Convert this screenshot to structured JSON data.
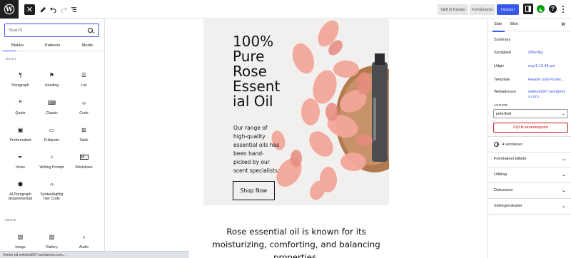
{
  "toolbar": {
    "logo_icon": "wordpress-logo",
    "inserter_icon": "close-icon",
    "tools_icon": "pen-icon",
    "undo_icon": "undo-icon",
    "redo_icon": "redo-icon",
    "outline_icon": "list-view-icon",
    "draft_label": "Skift til Kladde",
    "preview_label": "Forhåndsvis",
    "update_label": "Opdater",
    "settings_icon": "sidebar-icon",
    "jetpack_icon": "jetpack-icon",
    "help_label": "?",
    "more_icon": "more-vertical-icon"
  },
  "inserter": {
    "search_placeholder": "Search",
    "tabs": [
      "Blokke",
      "Patterns",
      "Medie"
    ],
    "active_tab": "Blokke",
    "categories": {
      "text": "TEKST",
      "media": "MEDIE"
    },
    "blocks": [
      {
        "label": "Paragraph",
        "icon": "¶"
      },
      {
        "label": "Heading",
        "icon": "⚑"
      },
      {
        "label": "List",
        "icon": "☰"
      },
      {
        "label": "Quote",
        "icon": "❞"
      },
      {
        "label": "Classic",
        "icon": "⌨"
      },
      {
        "label": "Code",
        "icon": "‹›"
      },
      {
        "label": "Preformatted",
        "icon": "▣"
      },
      {
        "label": "Pullquote",
        "icon": "▭"
      },
      {
        "label": "Table",
        "icon": "⊞"
      },
      {
        "label": "Verse",
        "icon": "✒"
      },
      {
        "label": "Writing Prompt",
        "icon": "♀"
      },
      {
        "label": "Markdown",
        "icon": "M↓"
      },
      {
        "label": "AI Paragraph (Experimental)",
        "icon": "⬢"
      },
      {
        "label": "SyntaxHighlighter Code",
        "icon": "‹›"
      }
    ],
    "media_blocks": [
      {
        "label": "Image",
        "icon": "▨"
      },
      {
        "label": "Gallery",
        "icon": "▧"
      },
      {
        "label": "Audio",
        "icon": "♪"
      }
    ]
  },
  "canvas": {
    "cover_title": "100% Pure Rose Essential Oil",
    "cover_text": "Our range of high-quality essential oils has been hand-picked by our scent specialists.",
    "cover_button": "Shop Now",
    "paragraph": "Rose essential oil is known for its moisturizing, comforting, and balancing properties."
  },
  "sidebar": {
    "tabs": [
      "Side",
      "Blok"
    ],
    "active_tab": "Side",
    "close_icon": "close-icon",
    "summary_title": "Summary",
    "rows": [
      {
        "label": "Synlighed",
        "value": "Offentlig"
      },
      {
        "label": "Udgiv",
        "value": "maj 9 12:45 pm"
      },
      {
        "label": "Template",
        "value": "Header and Footer..."
      },
      {
        "label": "Webadresse",
        "value": "webtest507.wordpress.com..."
      }
    ],
    "author_label": "AUTHOR",
    "author_value": "peterfwd",
    "trash_label": "Flyt til skraldespand",
    "versions_label": "4 versioner",
    "panels": [
      "Fremhævet billede",
      "Uddrag",
      "Diskussion",
      "Sideegenskaber"
    ]
  },
  "status_bar": "Venter på webtest507.wordpress.com...",
  "colors": {
    "accent": "#3858e9",
    "danger": "#cc1818",
    "dark": "#1e1e1e"
  }
}
